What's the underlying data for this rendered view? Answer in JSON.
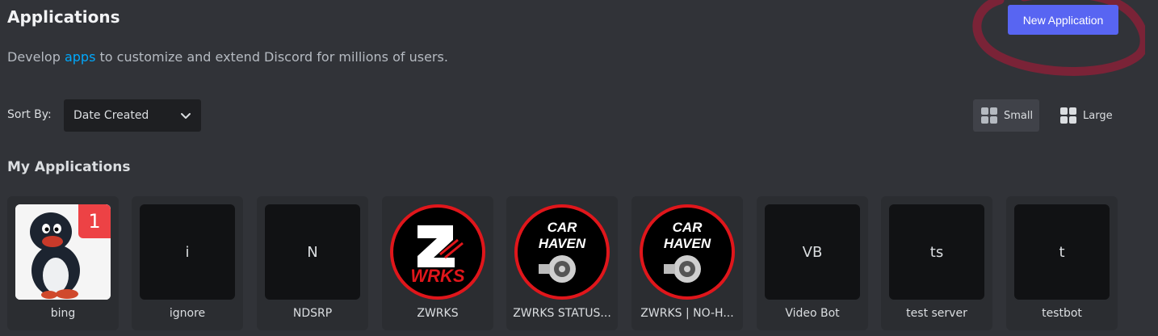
{
  "header": {
    "title": "Applications",
    "subtitle_before": "Develop ",
    "subtitle_link": "apps",
    "subtitle_after": " to customize and extend Discord for millions of users.",
    "new_app_label": "New Application"
  },
  "sort": {
    "label": "Sort By:",
    "selected": "Date Created"
  },
  "view": {
    "small_label": "Small",
    "large_label": "Large",
    "active": "Small"
  },
  "section_title": "My Applications",
  "apps": [
    {
      "name": "bing",
      "icon_text": "",
      "badge": "1",
      "logo": "pingu-image"
    },
    {
      "name": "ignore",
      "icon_text": "i"
    },
    {
      "name": "NDSRP",
      "icon_text": "N"
    },
    {
      "name": "ZWRKS",
      "logo": "zwrks-logo",
      "logo_text": "WRKS"
    },
    {
      "name": "ZWRKS STATUS...",
      "logo": "car-haven-logo",
      "logo_text_1": "CAR",
      "logo_text_2": "HAVEN"
    },
    {
      "name": "ZWRKS | NO-H...",
      "logo": "car-haven-logo",
      "logo_text_1": "CAR",
      "logo_text_2": "HAVEN"
    },
    {
      "name": "Video Bot",
      "icon_text": "VB"
    },
    {
      "name": "test server",
      "icon_text": "ts"
    },
    {
      "name": "testbot",
      "icon_text": "t"
    }
  ],
  "colors": {
    "background": "#313338",
    "card": "#2b2d31",
    "blurple": "#5865f2",
    "link": "#00a8fc",
    "badge_red": "#ed4245",
    "annotation": "#7a2337"
  }
}
